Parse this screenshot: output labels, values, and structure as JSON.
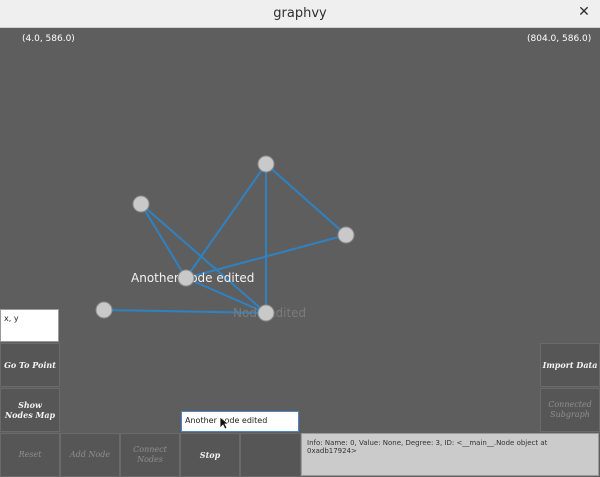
{
  "window": {
    "title": "graphvy",
    "close_glyph": "✕"
  },
  "canvas": {
    "top_left_coord": "(4.0, 586.0)",
    "top_right_coord": "(804.0, 586.0)"
  },
  "graph": {
    "nodes": [
      {
        "id": "n1",
        "label": ""
      },
      {
        "id": "n2",
        "label": ""
      },
      {
        "id": "n3",
        "label": ""
      },
      {
        "id": "n4",
        "label": "Another node edited"
      },
      {
        "id": "n5",
        "label": ""
      },
      {
        "id": "n6",
        "label": "Node edited"
      }
    ],
    "edge_color": "#2f82c2",
    "node_color": "#c9c9c9"
  },
  "left_panel": {
    "xy_value": "x, y",
    "go_to_point": "Go To Point",
    "show_nodes_map": "Show\nNodes Map"
  },
  "right_panel": {
    "import_data": "Import Data",
    "connected_subgraph": "Connected\nSubgraph"
  },
  "bottom_bar": {
    "reset": "Reset",
    "add_node": "Add Node",
    "connect_nodes": "Connect Nodes",
    "stop": "Stop"
  },
  "edit_field": {
    "value": "Another node edited"
  },
  "info_panel": {
    "text": "Info: Name: 0, Value: None, Degree: 3, ID: <__main__.Node object at 0xadb17924>"
  }
}
